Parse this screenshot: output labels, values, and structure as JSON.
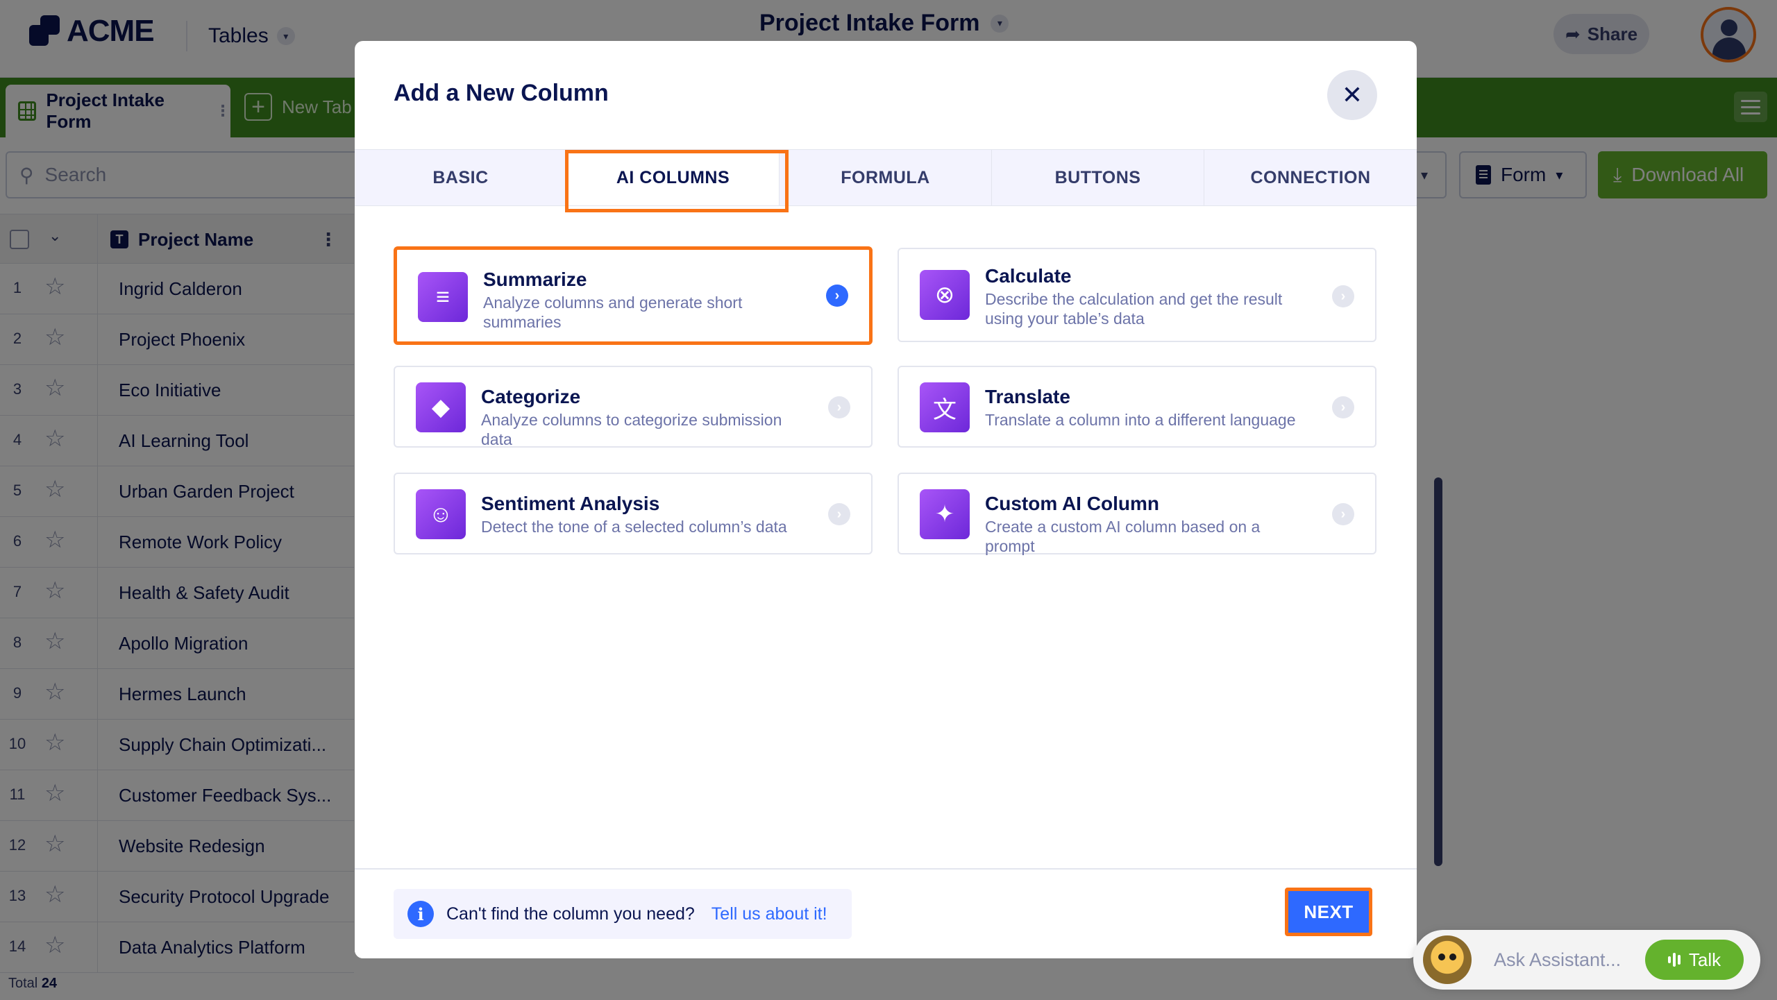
{
  "app": {
    "brand": "ACME",
    "nav_menu": "Tables",
    "title": "Project Intake Form",
    "share_label": "Share"
  },
  "tabbar": {
    "active_tab": "Project Intake Form",
    "new_tab": "New Tab"
  },
  "toolbar": {
    "search_placeholder": "Search",
    "form_label": "Form",
    "download_label": "Download All"
  },
  "grid": {
    "column_header": "Project Name",
    "rows": [
      {
        "num": "1",
        "name": "Ingrid Calderon"
      },
      {
        "num": "2",
        "name": "Project Phoenix"
      },
      {
        "num": "3",
        "name": "Eco Initiative"
      },
      {
        "num": "4",
        "name": "AI Learning Tool"
      },
      {
        "num": "5",
        "name": "Urban Garden Project"
      },
      {
        "num": "6",
        "name": "Remote Work Policy"
      },
      {
        "num": "7",
        "name": "Health & Safety Audit"
      },
      {
        "num": "8",
        "name": "Apollo Migration"
      },
      {
        "num": "9",
        "name": "Hermes Launch"
      },
      {
        "num": "10",
        "name": "Supply Chain Optimizati..."
      },
      {
        "num": "11",
        "name": "Customer Feedback Sys..."
      },
      {
        "num": "12",
        "name": "Website Redesign"
      },
      {
        "num": "13",
        "name": "Security Protocol Upgrade"
      },
      {
        "num": "14",
        "name": "Data Analytics Platform"
      }
    ],
    "total_label": "Total",
    "total_value": "24"
  },
  "modal": {
    "title": "Add a New Column",
    "tabs": [
      "BASIC",
      "AI COLUMNS",
      "FORMULA",
      "BUTTONS",
      "CONNECTION"
    ],
    "active_tab": "AI COLUMNS",
    "cards": [
      {
        "title": "Summarize",
        "desc": "Analyze columns and generate short summaries",
        "icon": "summarize-icon"
      },
      {
        "title": "Calculate",
        "desc": "Describe the calculation and get the result using your table’s data",
        "icon": "calculate-icon"
      },
      {
        "title": "Categorize",
        "desc": "Analyze columns to categorize submission data",
        "icon": "categorize-icon"
      },
      {
        "title": "Translate",
        "desc": "Translate a column into a different language",
        "icon": "translate-icon"
      },
      {
        "title": "Sentiment Analysis",
        "desc": "Detect the tone of a selected column’s data",
        "icon": "sentiment-icon"
      },
      {
        "title": "Custom AI Column",
        "desc": "Create a custom AI column based on a prompt",
        "icon": "sparkle-icon"
      }
    ],
    "footer": {
      "info_text": "Can't find the column you need?",
      "info_link": "Tell us about it!",
      "next_label": "NEXT"
    }
  },
  "assistant": {
    "placeholder": "Ask Assistant...",
    "talk_label": "Talk"
  },
  "colors": {
    "accent_green": "#3e8d1e",
    "button_green": "#64b22d",
    "primary_blue": "#2e69ff",
    "highlight_orange": "#f97316",
    "navy": "#0a1551"
  }
}
